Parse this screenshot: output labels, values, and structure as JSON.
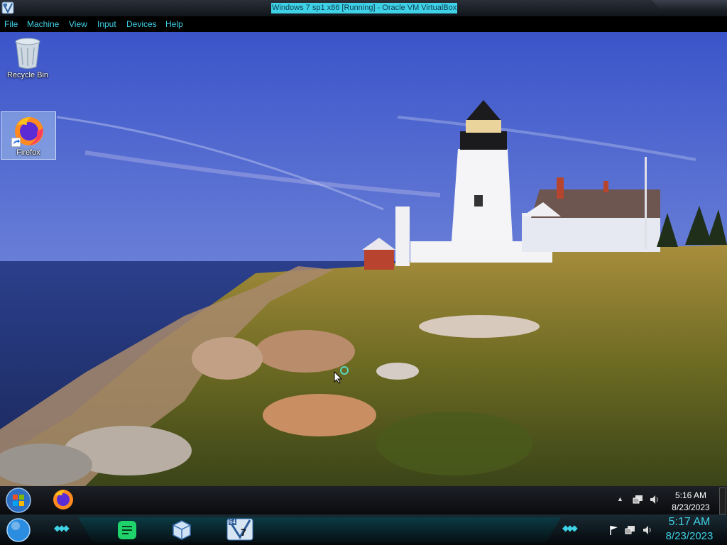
{
  "window": {
    "title": "Windows 7 sp1 x86 [Running] - Oracle VM VirtualBox",
    "app_icon": "virtualbox-icon"
  },
  "menu": {
    "items": [
      "File",
      "Machine",
      "View",
      "Input",
      "Devices",
      "Help"
    ]
  },
  "desktop": {
    "icons": [
      {
        "label": "Recycle Bin",
        "icon": "recycle-bin-icon"
      },
      {
        "label": "Firefox",
        "icon": "firefox-icon",
        "selected": true
      }
    ]
  },
  "guest_taskbar": {
    "start": "start-orb-icon",
    "pinned": [
      "firefox-icon"
    ],
    "tray_icons": [
      "show-hidden-icons-icon",
      "network-icon",
      "volume-icon"
    ],
    "time": "5:16 AM",
    "date": "8/23/2023"
  },
  "host_taskbar": {
    "start": "start-orb-icon",
    "apps": [
      "notes-app-icon",
      "virtualbox-icon",
      "windows7-vm-icon"
    ],
    "vm_badge": "64",
    "vm_version": "7",
    "tray_icons": [
      "action-center-flag-icon",
      "network-icon",
      "volume-icon"
    ],
    "time": "5:17 AM",
    "date": "8/23/2023"
  },
  "colors": {
    "accent": "#3fd2e6",
    "menubar_bg": "#000000",
    "taskbar_bg": "#0a0b0e"
  }
}
